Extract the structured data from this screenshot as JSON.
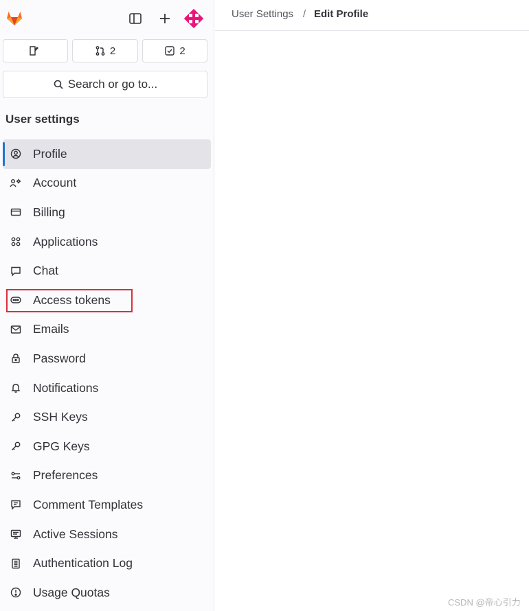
{
  "topbar": {
    "counts": [
      {
        "icon": "issues-icon",
        "value": ""
      },
      {
        "icon": "merge-request-icon",
        "value": "2"
      },
      {
        "icon": "todo-icon",
        "value": "2"
      }
    ]
  },
  "search": {
    "label": "Search or go to..."
  },
  "sidebar": {
    "title": "User settings",
    "items": [
      {
        "label": "Profile",
        "icon": "profile-icon",
        "active": true
      },
      {
        "label": "Account",
        "icon": "account-icon"
      },
      {
        "label": "Billing",
        "icon": "billing-icon"
      },
      {
        "label": "Applications",
        "icon": "applications-icon"
      },
      {
        "label": "Chat",
        "icon": "chat-icon"
      },
      {
        "label": "Access tokens",
        "icon": "access-tokens-icon"
      },
      {
        "label": "Emails",
        "icon": "email-icon"
      },
      {
        "label": "Password",
        "icon": "lock-icon"
      },
      {
        "label": "Notifications",
        "icon": "bell-icon"
      },
      {
        "label": "SSH Keys",
        "icon": "key-icon"
      },
      {
        "label": "GPG Keys",
        "icon": "key-icon"
      },
      {
        "label": "Preferences",
        "icon": "preferences-icon"
      },
      {
        "label": "Comment Templates",
        "icon": "comment-templates-icon"
      },
      {
        "label": "Active Sessions",
        "icon": "monitor-icon"
      },
      {
        "label": "Authentication Log",
        "icon": "log-icon"
      },
      {
        "label": "Usage Quotas",
        "icon": "usage-quotas-icon"
      }
    ]
  },
  "breadcrumb": {
    "parent": "User Settings",
    "separator": "/",
    "current": "Edit Profile"
  },
  "watermark": "CSDN @帝心引力",
  "colors": {
    "accent": "#1f75cb",
    "highlight": "#d9303a",
    "avatar": "#e7157b"
  }
}
